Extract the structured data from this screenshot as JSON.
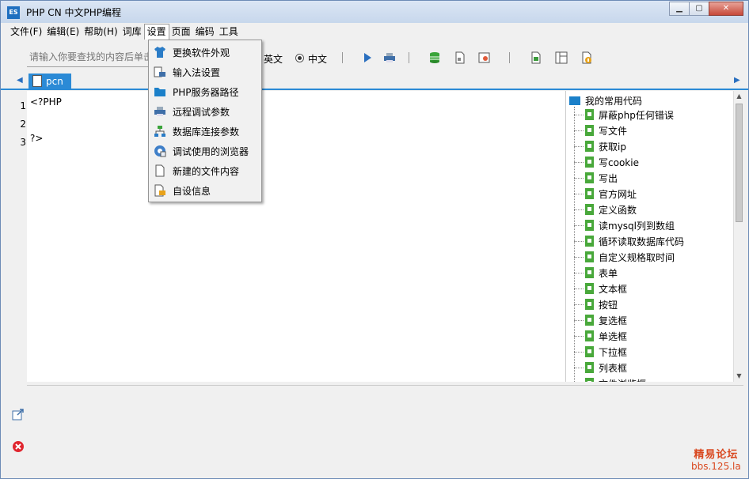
{
  "window": {
    "title": "PHP CN 中文PHP编程",
    "icon_text": "ES",
    "minimize": "▁",
    "maximize": "▢",
    "close": "✕"
  },
  "menubar": {
    "items": [
      "文件(F)",
      "编辑(E)",
      "帮助(H)",
      "词库",
      "设置",
      "页面",
      "编码",
      "工具"
    ]
  },
  "toolbar": {
    "search_placeholder": "请输入你要查找的内容后单击",
    "lang_en": "英文",
    "lang_zh": "中文"
  },
  "tab": {
    "label": "pcn",
    "prev": "◀",
    "next": "▶"
  },
  "editor": {
    "line_numbers": [
      "1",
      "2",
      "3"
    ],
    "lines": [
      "<?PHP",
      "",
      "?>"
    ]
  },
  "tree": {
    "root": "我的常用代码",
    "items": [
      "屏蔽php任何错误",
      "写文件",
      "获取ip",
      "写cookie",
      "写出",
      "官方网址",
      "定义函数",
      "读mysql列到数组",
      "循环读取数据库代码",
      "自定义规格取时间",
      "表单",
      "文本框",
      "按钮",
      "复选框",
      "单选框",
      "下拉框",
      "列表框",
      "文件浏览框"
    ]
  },
  "scrollbar": {
    "up": "▲",
    "down": "▼"
  },
  "settings_menu": {
    "items": [
      {
        "label": "更换软件外观",
        "icon": "shirt-icon"
      },
      {
        "label": "输入法设置",
        "icon": "keyboard-icon"
      },
      {
        "label": "PHP服务器路径",
        "icon": "folder-icon"
      },
      {
        "label": "远程调试参数",
        "icon": "printer-icon"
      },
      {
        "label": "数据库连接参数",
        "icon": "network-icon"
      },
      {
        "label": "调试使用的浏览器",
        "icon": "browser-icon"
      },
      {
        "label": "新建的文件内容",
        "icon": "file-icon"
      },
      {
        "label": "自设信息",
        "icon": "info-icon"
      }
    ]
  },
  "watermark": {
    "line1": "精易论坛",
    "line2": "bbs.125.la"
  },
  "colors": {
    "accent": "#2b8ad6",
    "tree_leaf": "#49a83b",
    "watermark": "#d9481f"
  }
}
